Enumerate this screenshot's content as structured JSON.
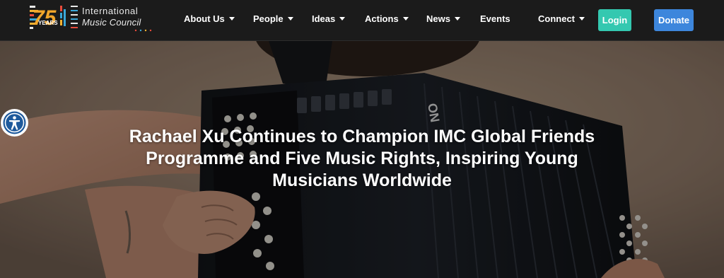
{
  "header": {
    "logo": {
      "years_number": "75",
      "years_label": "YEARS",
      "name_line1": "International",
      "name_line2": "Music Council"
    },
    "nav": [
      {
        "label": "About Us",
        "has_dropdown": true
      },
      {
        "label": "People",
        "has_dropdown": true
      },
      {
        "label": "Ideas",
        "has_dropdown": true
      },
      {
        "label": "Actions",
        "has_dropdown": true
      },
      {
        "label": "News",
        "has_dropdown": true
      },
      {
        "label": "Events",
        "has_dropdown": false
      },
      {
        "label": "Connect",
        "has_dropdown": true
      }
    ],
    "login_label": "Login",
    "donate_label": "Donate"
  },
  "hero": {
    "title": "Rachael Xu Continues to Champion IMC Global Friends Programme and Five Music Rights, Inspiring Young Musicians Worldwide",
    "instrument_text": "ON"
  },
  "accessibility": {
    "icon": "accessibility-icon"
  },
  "colors": {
    "header_bg": "#1b1b1b",
    "login_bg": "#34c8b0",
    "donate_bg": "#3d86dc",
    "a11y_blue": "#1e5a9c"
  }
}
